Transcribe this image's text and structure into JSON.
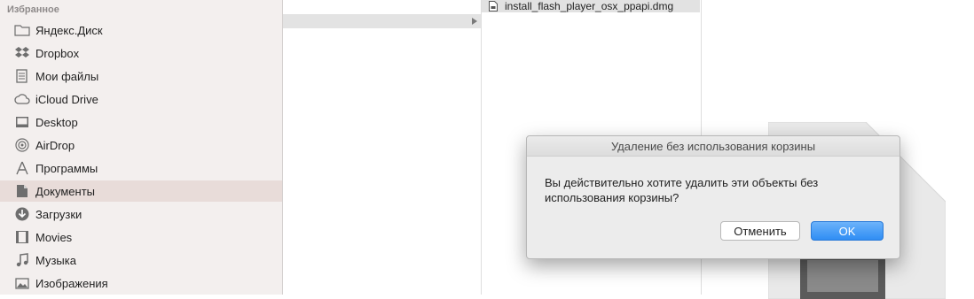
{
  "sidebar": {
    "header": "Избранное",
    "items": [
      {
        "label": "Яндекс.Диск",
        "icon": "folder-icon"
      },
      {
        "label": "Dropbox",
        "icon": "dropbox-icon"
      },
      {
        "label": "Мои файлы",
        "icon": "all-files-icon"
      },
      {
        "label": "iCloud Drive",
        "icon": "cloud-icon"
      },
      {
        "label": "Desktop",
        "icon": "desktop-icon"
      },
      {
        "label": "AirDrop",
        "icon": "airdrop-icon"
      },
      {
        "label": "Программы",
        "icon": "applications-icon"
      },
      {
        "label": "Документы",
        "icon": "documents-icon",
        "selected": true
      },
      {
        "label": "Загрузки",
        "icon": "downloads-icon"
      },
      {
        "label": "Movies",
        "icon": "movies-icon"
      },
      {
        "label": "Музыка",
        "icon": "music-icon"
      },
      {
        "label": "Изображения",
        "icon": "pictures-icon"
      }
    ]
  },
  "browser": {
    "selected_file": "install_flash_player_osx_ppapi.dmg"
  },
  "dialog": {
    "title": "Удаление без использования корзины",
    "message_line1": "Вы действительно хотите удалить эти объекты без",
    "message_line2": "использования корзины?",
    "cancel_label": "Отменить",
    "ok_label": "OK"
  },
  "colors": {
    "sidebar_bg": "#f3efee",
    "selected_bg": "#e8dcd9",
    "ok_button": "#2f8df4"
  }
}
